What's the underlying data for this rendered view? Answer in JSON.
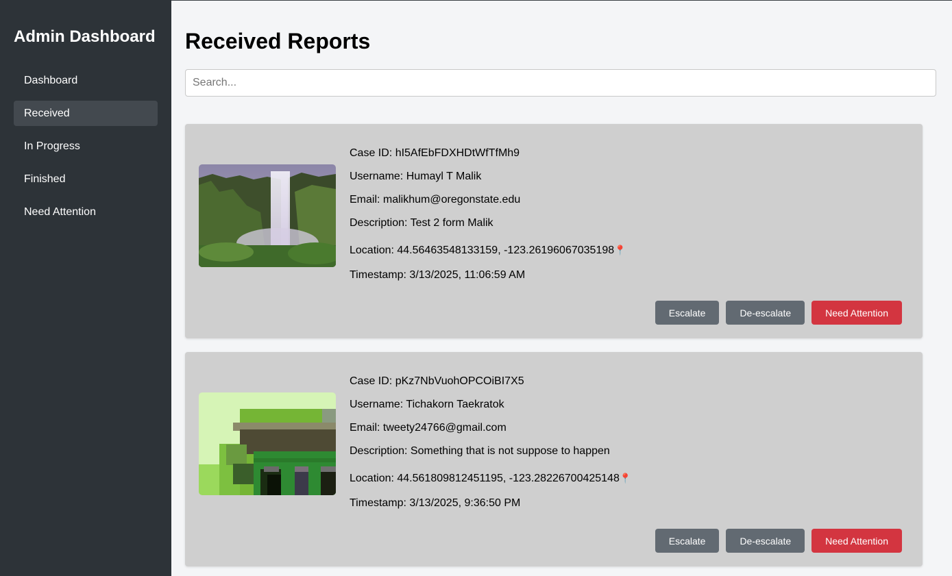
{
  "sidebar": {
    "title": "Admin Dashboard",
    "items": [
      {
        "label": "Dashboard"
      },
      {
        "label": "Received"
      },
      {
        "label": "In Progress"
      },
      {
        "label": "Finished"
      },
      {
        "label": "Need Attention"
      }
    ],
    "active": "Received"
  },
  "main": {
    "title": "Received Reports",
    "search": {
      "placeholder": "Search...",
      "value": ""
    }
  },
  "reports": [
    {
      "case_id": "Case ID: hI5AfEbFDXHDtWfTfMh9",
      "username": "Username: Humayl T Malik",
      "email": "Email: malikhum@oregonstate.edu",
      "description": "Description: Test 2 form Malik",
      "location": "Location: 44.56463548133159, -123.26196067035198",
      "timestamp": "Timestamp: 3/13/2025, 11:06:59 AM",
      "image": "waterfall-photo"
    },
    {
      "case_id": "Case ID: pKz7NbVuohOPCOiBI7X5",
      "username": "Username: Tichakorn Taekratok",
      "email": "Email: tweety24766@gmail.com",
      "description": "Description: Something that is not suppose to happen",
      "location": "Location: 44.561809812451195, -123.28226700425148",
      "timestamp": "Timestamp: 3/13/2025, 9:36:50 PM",
      "image": "pixelated-building-photo"
    }
  ],
  "buttons": {
    "escalate": "Escalate",
    "deescalate": "De-escalate",
    "need_attention": "Need Attention"
  },
  "icons": {
    "location": "pin-icon"
  },
  "colors": {
    "sidebar_bg": "#2d3338",
    "active_item_bg": "#43494f",
    "card_bg": "#cfcfcf",
    "gray_button": "#626a72",
    "red_button": "#d33540"
  }
}
